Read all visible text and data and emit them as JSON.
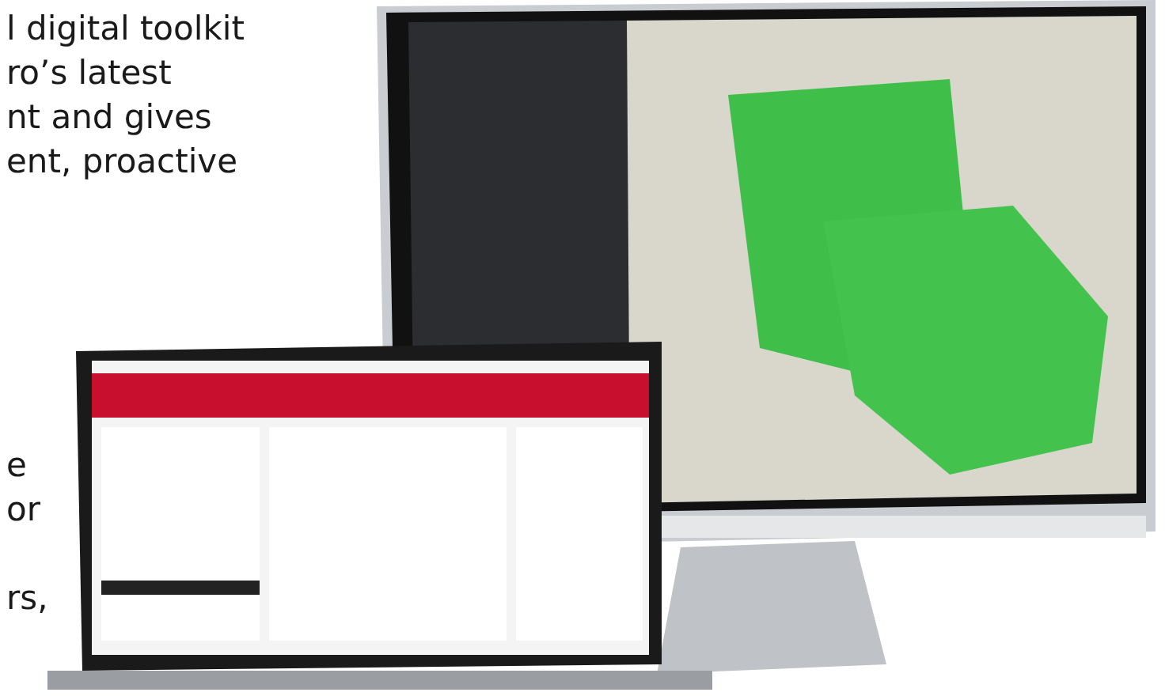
{
  "intro_text": {
    "lines": [
      "l digital toolkit",
      "ro’s latest",
      "nt and gives",
      "ent, proactive"
    ]
  },
  "lower_text": {
    "paragraphs": [
      [
        "e",
        "or"
      ],
      [
        "rs,"
      ]
    ]
  }
}
